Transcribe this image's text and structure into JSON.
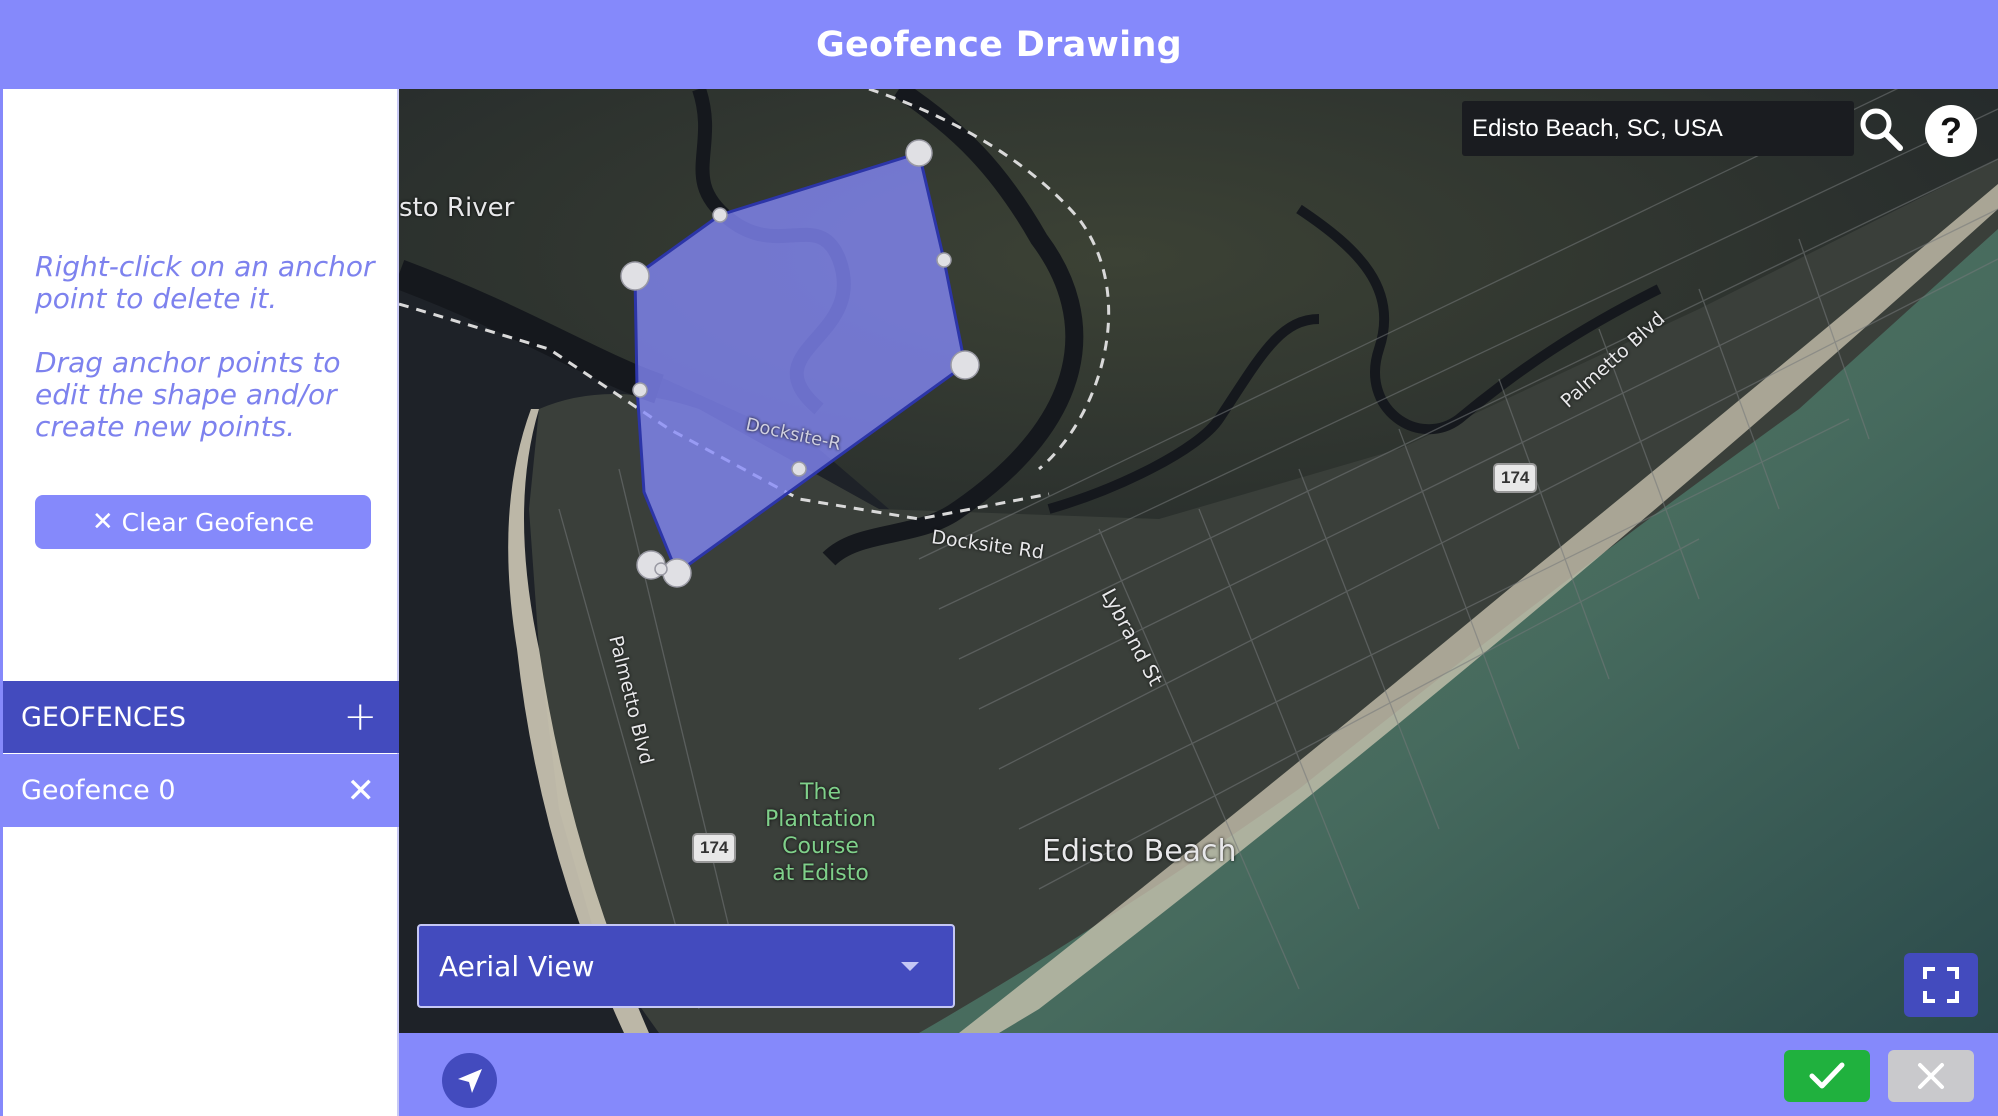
{
  "window": {
    "title": "Geofence Drawing"
  },
  "sidebar": {
    "hint_delete": "Right-click on an anchor point to delete it.",
    "hint_drag": "Drag anchor points to edit the shape and/or create new points.",
    "clear_button_icon": "✕",
    "clear_button_label": "Clear Geofence",
    "geofences_header": "GEOFENCES",
    "add_icon": "+",
    "items": [
      {
        "label": "Geofence 0",
        "remove_icon": "✕"
      }
    ]
  },
  "map": {
    "search": {
      "value": "Edisto Beach, SC, USA"
    },
    "help_icon": "?",
    "labels": {
      "river": "sto River",
      "docksite1": "Docksite-R",
      "docksite2": "Docksite Rd",
      "lybrand": "Lybrand St",
      "palmetto1": "Palmetto Blvd",
      "palmetto2": "Palmetto Blvd",
      "course": "The\nPlantation\nCourse\nat Edisto",
      "town": "Edisto Beach",
      "route_a": "174",
      "route_b": "174"
    },
    "view_select": {
      "value": "Aerial View"
    },
    "geofence_color": "#8589fb",
    "geofence_stroke": "#2c35a8"
  },
  "colors": {
    "accent": "#8589fb",
    "dark_accent": "#434bbe",
    "confirm": "#20b13e",
    "cancel": "#c9c9cc"
  },
  "icons": {
    "search": "search-icon",
    "help": "help-icon",
    "fullscreen": "fullscreen-icon",
    "navigate": "navigate-arrow-icon",
    "confirm": "checkmark-icon",
    "cancel": "close-icon"
  }
}
